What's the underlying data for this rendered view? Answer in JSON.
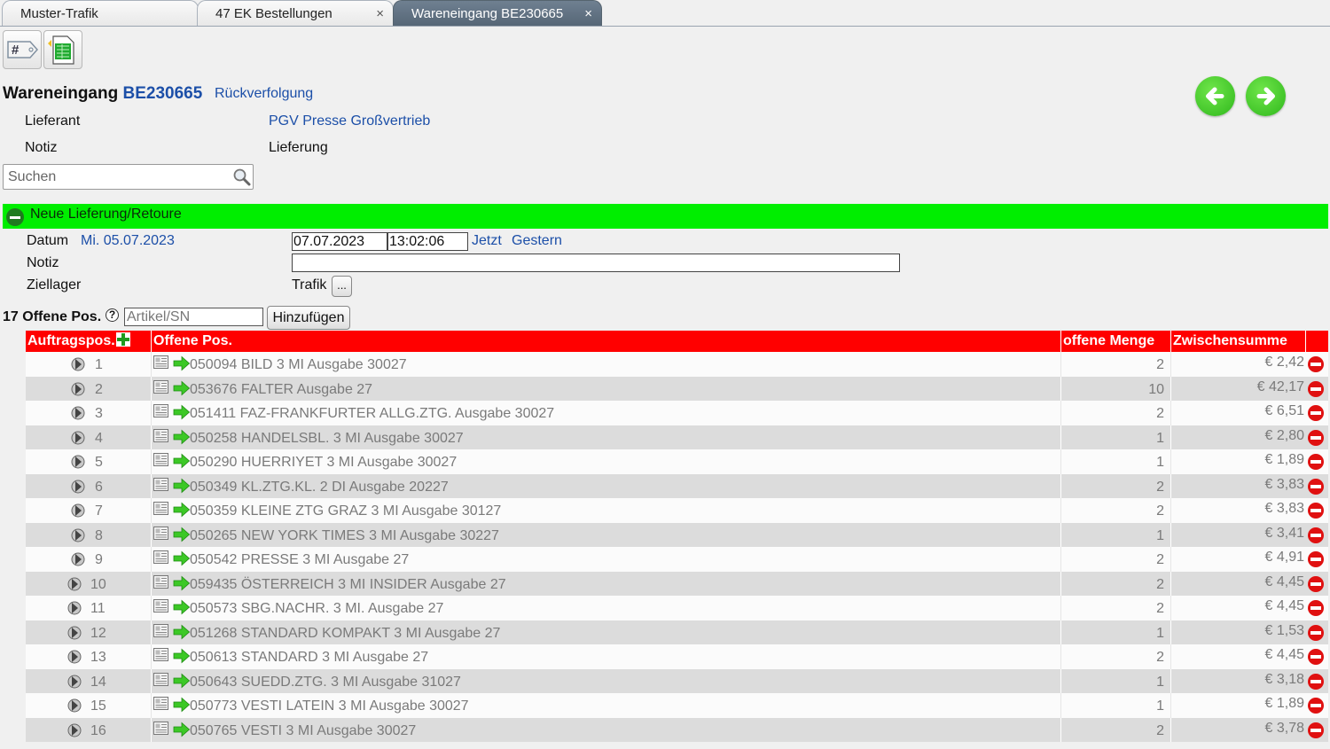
{
  "tabs": [
    {
      "label": "Muster-Trafik",
      "closable": false,
      "active": false
    },
    {
      "label": "47 EK Bestellungen",
      "closable": true,
      "active": false
    },
    {
      "label": "Wareneingang BE230665",
      "closable": true,
      "active": true
    }
  ],
  "tab_close_glyph": "×",
  "toolbar": {
    "tag_icon": "hash-tag-icon",
    "export_icon": "excel-document-icon",
    "tag_text": "#"
  },
  "header": {
    "title": "Wareneingang",
    "number": "BE230665",
    "trace_link": "Rückverfolgung",
    "supplier_label": "Lieferant",
    "supplier_value": "PGV Presse Großvertrieb",
    "note_label": "Notiz",
    "note_value": "Lieferung"
  },
  "search": {
    "placeholder": "Suchen"
  },
  "delivery": {
    "section_title": "Neue Lieferung/Retoure",
    "date_label": "Datum",
    "date_display": "Mi. 05.07.2023",
    "date_value": "07.07.2023",
    "time_value": "13:02:06",
    "now_link": "Jetzt",
    "yesterday_link": "Gestern",
    "note_label": "Notiz",
    "note_value": "",
    "target_label": "Ziellager",
    "target_value": "Trafik",
    "target_button": "..."
  },
  "open_positions": {
    "count_label": "17 Offene Pos.",
    "help_glyph": "?",
    "article_placeholder": "Artikel/SN",
    "add_button": "Hinzufügen"
  },
  "table": {
    "columns": [
      "Auftragspos.",
      "Offene Pos.",
      "offene Menge",
      "Zwischensumme"
    ],
    "rows": [
      {
        "pos": "1",
        "article": "050094 BILD 3 MI Ausgabe 30027",
        "qty": "2",
        "sum": "€ 2,42"
      },
      {
        "pos": "2",
        "article": "053676 FALTER Ausgabe 27",
        "qty": "10",
        "sum": "€ 42,17"
      },
      {
        "pos": "3",
        "article": "051411 FAZ-FRANKFURTER ALLG.ZTG. Ausgabe 30027",
        "qty": "2",
        "sum": "€ 6,51"
      },
      {
        "pos": "4",
        "article": "050258 HANDELSBL. 3 MI Ausgabe 30027",
        "qty": "1",
        "sum": "€ 2,80"
      },
      {
        "pos": "5",
        "article": "050290 HUERRIYET 3 MI Ausgabe 30027",
        "qty": "1",
        "sum": "€ 1,89"
      },
      {
        "pos": "6",
        "article": "050349 KL.ZTG.KL. 2 DI Ausgabe 20227",
        "qty": "2",
        "sum": "€ 3,83"
      },
      {
        "pos": "7",
        "article": "050359 KLEINE ZTG GRAZ 3 MI Ausgabe 30127",
        "qty": "2",
        "sum": "€ 3,83"
      },
      {
        "pos": "8",
        "article": "050265 NEW YORK TIMES 3 MI Ausgabe 30227",
        "qty": "1",
        "sum": "€ 3,41"
      },
      {
        "pos": "9",
        "article": "050542 PRESSE 3 MI Ausgabe 27",
        "qty": "2",
        "sum": "€ 4,91"
      },
      {
        "pos": "10",
        "article": "059435 ÖSTERREICH 3 MI INSIDER Ausgabe 27",
        "qty": "2",
        "sum": "€ 4,45"
      },
      {
        "pos": "11",
        "article": "050573 SBG.NACHR. 3 MI. Ausgabe 27",
        "qty": "2",
        "sum": "€ 4,45"
      },
      {
        "pos": "12",
        "article": "051268 STANDARD KOMPAKT 3 MI Ausgabe 27",
        "qty": "1",
        "sum": "€ 1,53"
      },
      {
        "pos": "13",
        "article": "050613 STANDARD 3 MI Ausgabe 27",
        "qty": "2",
        "sum": "€ 4,45"
      },
      {
        "pos": "14",
        "article": "050643 SUEDD.ZTG. 3 MI Ausgabe 31027",
        "qty": "1",
        "sum": "€ 3,18"
      },
      {
        "pos": "15",
        "article": "050773 VESTI LATEIN 3 MI Ausgabe 30027",
        "qty": "1",
        "sum": "€ 1,89"
      },
      {
        "pos": "16",
        "article": "050765 VESTI 3 MI Ausgabe 30027",
        "qty": "2",
        "sum": "€ 3,78"
      }
    ]
  },
  "colors": {
    "section_green": "#00ee00",
    "table_header_red": "#ff0000",
    "link_blue": "#1c4fa8",
    "nav_green": "#3cc826"
  }
}
